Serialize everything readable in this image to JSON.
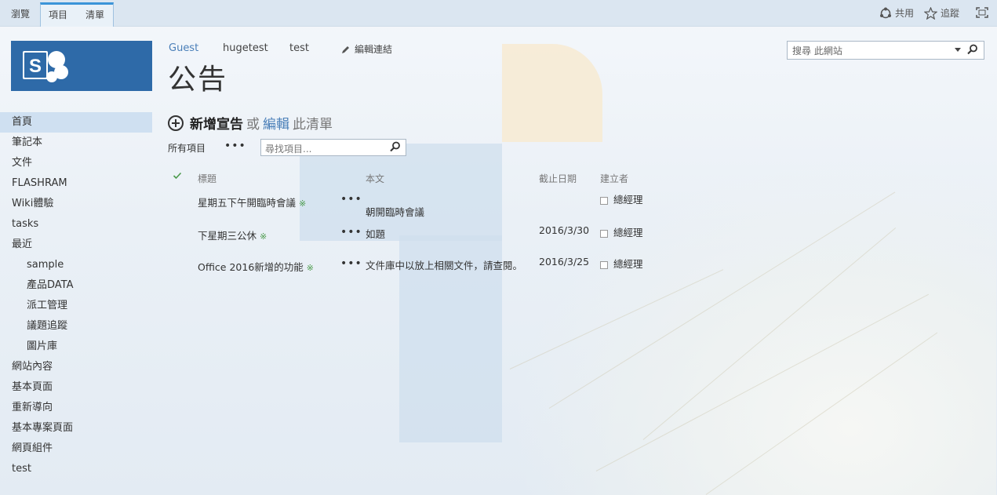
{
  "suitebar": {
    "browse_tab": "瀏覽",
    "items_tab": "項目",
    "list_tab": "清單",
    "share_label": "共用",
    "follow_label": "追蹤",
    "focus_icon": "fullscreen-icon"
  },
  "breadcrumb": {
    "guest": "Guest",
    "hugetest": "hugetest",
    "test": "test",
    "edit_links": "編輯連結"
  },
  "page_title": "公告",
  "site_search": {
    "placeholder": "搜尋 此網站"
  },
  "sidebar": {
    "items": [
      {
        "label": "首頁",
        "active": true,
        "sub": false
      },
      {
        "label": "筆記本",
        "sub": false
      },
      {
        "label": "文件",
        "sub": false
      },
      {
        "label": "FLASHRAM",
        "sub": false
      },
      {
        "label": "Wiki體驗",
        "sub": false
      },
      {
        "label": "tasks",
        "sub": false
      },
      {
        "label": "最近",
        "sub": false
      },
      {
        "label": "sample",
        "sub": true
      },
      {
        "label": "產品DATA",
        "sub": true
      },
      {
        "label": "派工管理",
        "sub": true
      },
      {
        "label": "議題追蹤",
        "sub": true
      },
      {
        "label": "圖片庫",
        "sub": true
      },
      {
        "label": "網站內容",
        "sub": false
      },
      {
        "label": "基本頁面",
        "sub": false
      },
      {
        "label": "重新導向",
        "sub": false
      },
      {
        "label": "基本專案頁面",
        "sub": false
      },
      {
        "label": "網頁組件",
        "sub": false
      },
      {
        "label": "test",
        "sub": false
      }
    ]
  },
  "newbar": {
    "new_label": "新增宣告",
    "or_label": "或",
    "edit_label": "編輯",
    "list_label": "此清單"
  },
  "view": {
    "all_items": "所有項目",
    "more": "•••",
    "search_placeholder": "尋找項目..."
  },
  "table": {
    "headers": {
      "title": "標題",
      "body": "本文",
      "expires": "截止日期",
      "created_by": "建立者"
    },
    "rows": [
      {
        "title": "星期五下午開臨時會議",
        "new": "※",
        "body": "朝開臨時會議",
        "expires": "",
        "created_by": "總經理"
      },
      {
        "title": "下星期三公休",
        "new": "※",
        "body": "如題",
        "expires": "2016/3/30",
        "created_by": "總經理"
      },
      {
        "title": "Office 2016新增的功能",
        "new": "※",
        "body": "文件庫中以放上相關文件，請查閱。",
        "expires": "2016/3/25",
        "created_by": "總經理"
      }
    ],
    "row_menu": "•••"
  },
  "colors": {
    "accent": "#2e6aa8",
    "suitebar_bg": "#dbe6f1",
    "active_nav": "#cfe0f1",
    "link": "#4a7fb8"
  }
}
